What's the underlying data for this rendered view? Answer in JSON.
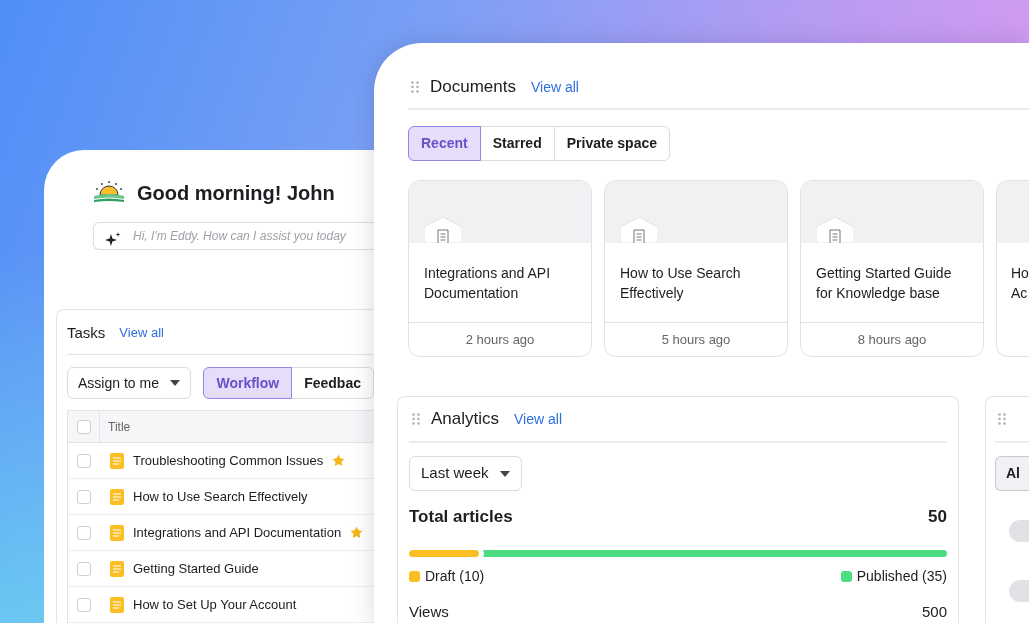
{
  "greeting": {
    "title": "Good morning! John",
    "placeholder": "Hi, I'm Eddy. How can I assist you today"
  },
  "tasks": {
    "title": "Tasks",
    "view_all": "View all",
    "filter": "Assign to me",
    "tabs": [
      {
        "label": "Workflow",
        "selected": true
      },
      {
        "label": "Feedbac",
        "selected": false
      }
    ],
    "table": {
      "columns": [
        "Title"
      ],
      "header_checked": false,
      "rows": [
        {
          "title": "Troubleshooting Common Issues",
          "starred": true,
          "checked": false
        },
        {
          "title": "How to Use Search Effectively",
          "starred": false,
          "checked": false
        },
        {
          "title": "Integrations and API Documentation",
          "starred": true,
          "checked": false
        },
        {
          "title": "Getting Started Guide",
          "starred": false,
          "checked": false
        },
        {
          "title": "How to Set Up Your Account",
          "starred": false,
          "checked": false
        }
      ]
    }
  },
  "documents": {
    "title": "Documents",
    "view_all": "View all",
    "tabs": [
      {
        "label": "Recent",
        "selected": true
      },
      {
        "label": "Starred",
        "selected": false
      },
      {
        "label": "Private space",
        "selected": false
      }
    ],
    "cards": [
      {
        "title": "Integrations and API Documentation",
        "time": "2 hours ago"
      },
      {
        "title": "How to Use Search Effectively",
        "time": "5 hours ago"
      },
      {
        "title": "Getting Started Guide for Knowledge base",
        "time": "8 hours ago"
      }
    ],
    "partial_card": {
      "lines": [
        "Ho",
        "Ac"
      ]
    }
  },
  "analytics": {
    "title": "Analytics",
    "view_all": "View all",
    "period": "Last week",
    "total_label": "Total articles",
    "total": "50",
    "segments": [
      {
        "label": "Draft (10)",
        "color": "#fbbf24",
        "level": 0.13
      },
      {
        "label": "Published (35)",
        "color": "#4ade80"
      }
    ],
    "views_label": "Views",
    "views": "500"
  },
  "side_panel": {
    "tab": "Al"
  }
}
